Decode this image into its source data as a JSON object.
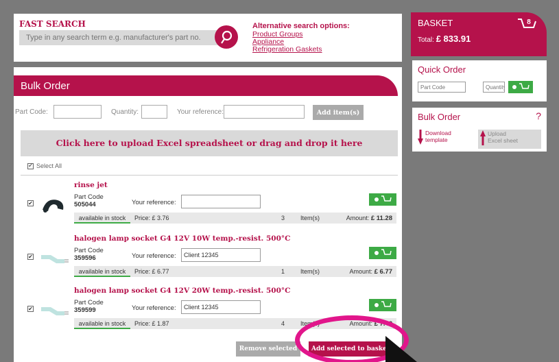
{
  "fast_search": {
    "title": "FAST SEARCH",
    "placeholder": "Type in any search term e.g. manufacturer's part no.",
    "alt_title": "Alternative search options:",
    "links": [
      "Product Groups",
      "Appliance",
      "Refrigeration Gaskets"
    ]
  },
  "bulk_order": {
    "title": "Bulk Order",
    "part_code_label": "Part Code:",
    "quantity_label": "Quantity:",
    "reference_label": "Your reference:",
    "add_items_label": "Add item(s)",
    "upload_text": "Click here to upload Excel spreadsheet or drag and drop it here",
    "select_all": "Select All",
    "items": [
      {
        "name": "rinse jet",
        "part_code_label": "Part Code",
        "part_code": "505044",
        "reference_label": "Your reference:",
        "reference": "",
        "stock": "available in stock",
        "price": "Price: £ 3.76",
        "qty": "3",
        "qty_unit": "Item(s)",
        "amount_label": "Amount:",
        "amount": "£ 11.28"
      },
      {
        "name": "halogen lamp socket G4 12V 10W temp.-resist. 500°C",
        "part_code_label": "Part Code",
        "part_code": "359596",
        "reference_label": "Your reference:",
        "reference": "Client 12345",
        "stock": "available in stock",
        "price": "Price: £ 6.77",
        "qty": "1",
        "qty_unit": "Item(s)",
        "amount_label": "Amount:",
        "amount": "£ 6.77"
      },
      {
        "name": "halogen lamp socket G4 12V 20W temp.-resist. 500°C",
        "part_code_label": "Part Code",
        "part_code": "359599",
        "reference_label": "Your reference:",
        "reference": "Client 12345",
        "stock": "available in stock",
        "price": "Price: £ 1.87",
        "qty": "4",
        "qty_unit": "Item(s)",
        "amount_label": "Amount:",
        "amount": "£ 7.48"
      }
    ],
    "remove_label": "Remove selected",
    "add_basket_label": "Add selected to basket"
  },
  "basket": {
    "title": "BASKET",
    "count": "8",
    "total_label": "Total:",
    "total": "£ 833.91"
  },
  "quick_order": {
    "title": "Quick Order",
    "part_code_placeholder": "Part Code",
    "quantity_placeholder": "Quantity"
  },
  "bulk_side": {
    "title": "Bulk Order",
    "help": "?",
    "download": "Download template",
    "upload": "Upload Excel sheet"
  },
  "colors": {
    "brand": "#b5124b",
    "cart_green": "#3daa45",
    "highlight": "#e1168b"
  }
}
